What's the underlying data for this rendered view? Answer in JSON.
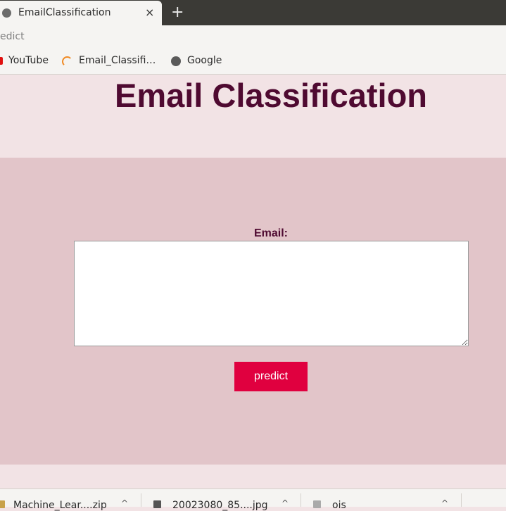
{
  "browser": {
    "tab": {
      "title": "EmailClassification",
      "favicon": "globe-icon",
      "close": "×"
    },
    "new_tab": "+",
    "url": "edict",
    "bookmarks": [
      {
        "label": "YouTube",
        "icon": "youtube-icon"
      },
      {
        "label": "Email_Classifi…",
        "icon": "loading-icon"
      },
      {
        "label": "Google",
        "icon": "globe-icon"
      }
    ]
  },
  "page": {
    "title": "Email Classification",
    "form": {
      "email_label": "Email:",
      "email_value": "",
      "submit_label": "predict"
    }
  },
  "downloads": [
    {
      "label": "Machine_Lear....zip"
    },
    {
      "label": "20023080_85....jpg"
    },
    {
      "label": "ois"
    }
  ],
  "colors": {
    "title": "#4f0a31",
    "header_bg": "#f2e3e5",
    "form_bg": "#e2c5c9",
    "button_bg": "#e0003f"
  }
}
